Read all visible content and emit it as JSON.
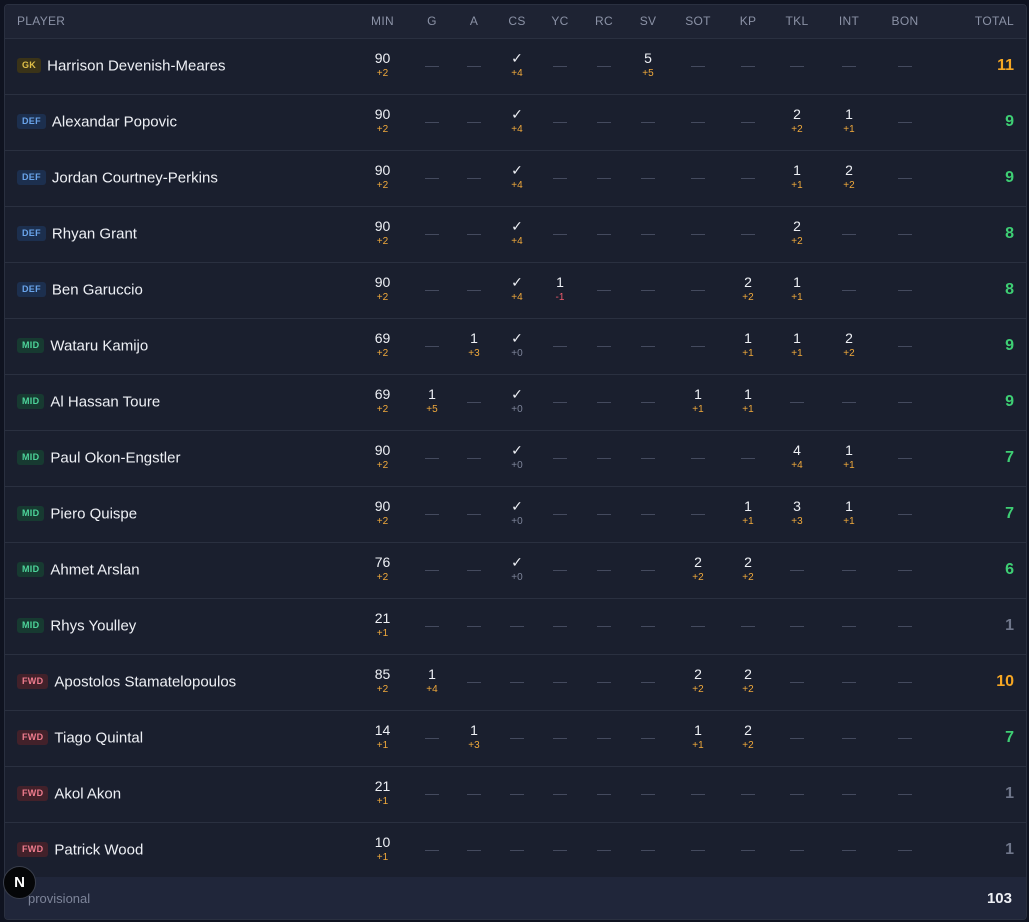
{
  "columns": [
    "PLAYER",
    "MIN",
    "G",
    "A",
    "CS",
    "YC",
    "RC",
    "SV",
    "SOT",
    "KP",
    "TKL",
    "INT",
    "BON",
    "TOTAL"
  ],
  "dash": "—",
  "check": "✓",
  "players": [
    {
      "pos": "GK",
      "name": "Harrison Devenish-Meares",
      "total": "11",
      "tier": "high",
      "stats": {
        "MIN": [
          "90",
          "+2"
        ],
        "CS": [
          "✓",
          "+4"
        ],
        "SV": [
          "5",
          "+5"
        ]
      }
    },
    {
      "pos": "DEF",
      "name": "Alexandar Popovic",
      "total": "9",
      "tier": "good",
      "stats": {
        "MIN": [
          "90",
          "+2"
        ],
        "CS": [
          "✓",
          "+4"
        ],
        "TKL": [
          "2",
          "+2"
        ],
        "INT": [
          "1",
          "+1"
        ]
      }
    },
    {
      "pos": "DEF",
      "name": "Jordan Courtney-Perkins",
      "total": "9",
      "tier": "good",
      "stats": {
        "MIN": [
          "90",
          "+2"
        ],
        "CS": [
          "✓",
          "+4"
        ],
        "TKL": [
          "1",
          "+1"
        ],
        "INT": [
          "2",
          "+2"
        ]
      }
    },
    {
      "pos": "DEF",
      "name": "Rhyan Grant",
      "total": "8",
      "tier": "good",
      "stats": {
        "MIN": [
          "90",
          "+2"
        ],
        "CS": [
          "✓",
          "+4"
        ],
        "TKL": [
          "2",
          "+2"
        ]
      }
    },
    {
      "pos": "DEF",
      "name": "Ben Garuccio",
      "total": "8",
      "tier": "good",
      "stats": {
        "MIN": [
          "90",
          "+2"
        ],
        "CS": [
          "✓",
          "+4"
        ],
        "YC": [
          "1",
          "-1"
        ],
        "KP": [
          "2",
          "+2"
        ],
        "TKL": [
          "1",
          "+1"
        ]
      }
    },
    {
      "pos": "MID",
      "name": "Wataru Kamijo",
      "total": "9",
      "tier": "good",
      "stats": {
        "MIN": [
          "69",
          "+2"
        ],
        "A": [
          "1",
          "+3"
        ],
        "CS": [
          "✓",
          "+0"
        ],
        "KP": [
          "1",
          "+1"
        ],
        "TKL": [
          "1",
          "+1"
        ],
        "INT": [
          "2",
          "+2"
        ]
      }
    },
    {
      "pos": "MID",
      "name": "Al Hassan Toure",
      "total": "9",
      "tier": "good",
      "stats": {
        "MIN": [
          "69",
          "+2"
        ],
        "G": [
          "1",
          "+5"
        ],
        "CS": [
          "✓",
          "+0"
        ],
        "SOT": [
          "1",
          "+1"
        ],
        "KP": [
          "1",
          "+1"
        ]
      }
    },
    {
      "pos": "MID",
      "name": "Paul Okon-Engstler",
      "total": "7",
      "tier": "good",
      "stats": {
        "MIN": [
          "90",
          "+2"
        ],
        "CS": [
          "✓",
          "+0"
        ],
        "TKL": [
          "4",
          "+4"
        ],
        "INT": [
          "1",
          "+1"
        ]
      }
    },
    {
      "pos": "MID",
      "name": "Piero Quispe",
      "total": "7",
      "tier": "good",
      "stats": {
        "MIN": [
          "90",
          "+2"
        ],
        "CS": [
          "✓",
          "+0"
        ],
        "KP": [
          "1",
          "+1"
        ],
        "TKL": [
          "3",
          "+3"
        ],
        "INT": [
          "1",
          "+1"
        ]
      }
    },
    {
      "pos": "MID",
      "name": "Ahmet Arslan",
      "total": "6",
      "tier": "good",
      "stats": {
        "MIN": [
          "76",
          "+2"
        ],
        "CS": [
          "✓",
          "+0"
        ],
        "SOT": [
          "2",
          "+2"
        ],
        "KP": [
          "2",
          "+2"
        ]
      }
    },
    {
      "pos": "MID",
      "name": "Rhys Youlley",
      "total": "1",
      "tier": "low",
      "stats": {
        "MIN": [
          "21",
          "+1"
        ]
      }
    },
    {
      "pos": "FWD",
      "name": "Apostolos Stamatelopoulos",
      "total": "10",
      "tier": "high",
      "stats": {
        "MIN": [
          "85",
          "+2"
        ],
        "G": [
          "1",
          "+4"
        ],
        "SOT": [
          "2",
          "+2"
        ],
        "KP": [
          "2",
          "+2"
        ]
      }
    },
    {
      "pos": "FWD",
      "name": "Tiago Quintal",
      "total": "7",
      "tier": "good",
      "stats": {
        "MIN": [
          "14",
          "+1"
        ],
        "A": [
          "1",
          "+3"
        ],
        "SOT": [
          "1",
          "+1"
        ],
        "KP": [
          "2",
          "+2"
        ]
      }
    },
    {
      "pos": "FWD",
      "name": "Akol Akon",
      "total": "1",
      "tier": "low",
      "stats": {
        "MIN": [
          "21",
          "+1"
        ]
      }
    },
    {
      "pos": "FWD",
      "name": "Patrick Wood",
      "total": "1",
      "tier": "low",
      "stats": {
        "MIN": [
          "10",
          "+1"
        ]
      }
    }
  ],
  "footer": {
    "note": "provisional",
    "total": "103"
  },
  "dev_button": {
    "label": "N"
  },
  "colors": {
    "high": "#f5a623",
    "good": "#3ecf74",
    "low": "#6f768a",
    "plus": "#f0a93b",
    "minus": "#ef5b6c"
  }
}
